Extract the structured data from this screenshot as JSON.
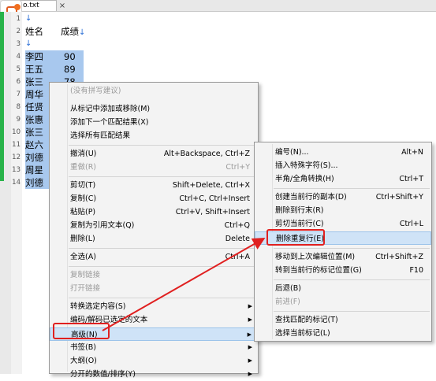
{
  "tab": {
    "title": "o.txt",
    "close": "×"
  },
  "editor": {
    "lines": [
      {
        "no": "1",
        "text": "↓"
      },
      {
        "no": "2",
        "name": "姓名",
        "score": "成绩"
      },
      {
        "no": "3",
        "text": "↓"
      },
      {
        "no": "4",
        "name": "李四",
        "score": "90"
      },
      {
        "no": "5",
        "name": "王五",
        "score": "89"
      },
      {
        "no": "6",
        "name": "张三",
        "score": "78"
      },
      {
        "no": "7",
        "name": "周华",
        "score": ""
      },
      {
        "no": "8",
        "name": "任贤",
        "score": ""
      },
      {
        "no": "9",
        "name": "张惠",
        "score": ""
      },
      {
        "no": "10",
        "name": "张三",
        "score": ""
      },
      {
        "no": "11",
        "name": "赵六",
        "score": ""
      },
      {
        "no": "12",
        "name": "刘德",
        "score": ""
      },
      {
        "no": "13",
        "name": "周星",
        "score": ""
      },
      {
        "no": "14",
        "name": "刘德",
        "score": ""
      }
    ]
  },
  "context_menu": {
    "items": [
      {
        "label": "(没有拼写建议)",
        "disabled": true
      },
      {
        "label": "从标记中添加或移除(M)"
      },
      {
        "label": "添加下一个匹配结果(X)"
      },
      {
        "label": "选择所有匹配结果"
      },
      {
        "label": "撤消(U)",
        "shortcut": "Alt+Backspace, Ctrl+Z"
      },
      {
        "label": "重做(R)",
        "shortcut": "Ctrl+Y",
        "disabled": true
      },
      {
        "label": "剪切(T)",
        "shortcut": "Shift+Delete, Ctrl+X"
      },
      {
        "label": "复制(C)",
        "shortcut": "Ctrl+C, Ctrl+Insert"
      },
      {
        "label": "粘贴(P)",
        "shortcut": "Ctrl+V, Shift+Insert"
      },
      {
        "label": "复制为引用文本(Q)",
        "shortcut": "Ctrl+Q"
      },
      {
        "label": "删除(L)",
        "shortcut": "Delete"
      },
      {
        "label": "全选(A)",
        "shortcut": "Ctrl+A"
      },
      {
        "label": "复制链接",
        "disabled": true
      },
      {
        "label": "打开链接",
        "disabled": true
      },
      {
        "label": "转换选定内容(S)",
        "submenu": "▶"
      },
      {
        "label": "编码/解码已选定的文本",
        "submenu": "▶"
      },
      {
        "label": "高级(N)",
        "submenu": "▶"
      },
      {
        "label": "书签(B)",
        "submenu": "▶"
      },
      {
        "label": "大纲(O)",
        "submenu": "▶"
      },
      {
        "label": "分开的数值/排序(Y)",
        "submenu": "▶"
      }
    ]
  },
  "submenu": {
    "items": [
      {
        "label": "编号(N)...",
        "shortcut": "Alt+N"
      },
      {
        "label": "插入特殊字符(S)..."
      },
      {
        "label": "半角/全角转换(H)",
        "shortcut": "Ctrl+T"
      },
      {
        "label": "创建当前行的副本(D)",
        "shortcut": "Ctrl+Shift+Y"
      },
      {
        "label": "删除到行末(R)"
      },
      {
        "label": "剪切当前行(C)",
        "shortcut": "Ctrl+L"
      },
      {
        "label": "删除重复行(E)"
      },
      {
        "label": "移动到上次编辑位置(M)",
        "shortcut": "Ctrl+Shift+Z"
      },
      {
        "label": "转到当前行的标记位置(G)",
        "shortcut": "F10"
      },
      {
        "label": "后退(B)"
      },
      {
        "label": "前进(F)",
        "disabled": true
      },
      {
        "label": "查找匹配的标记(T)"
      },
      {
        "label": "选择当前标记(L)"
      }
    ]
  },
  "colors": {
    "accent_red": "#e02020",
    "selection": "#a8c8ee",
    "green_bar": "#29b34a"
  },
  "icons": {
    "app": "app-logo-icon",
    "score_newline": "newline-arrow-icon"
  }
}
